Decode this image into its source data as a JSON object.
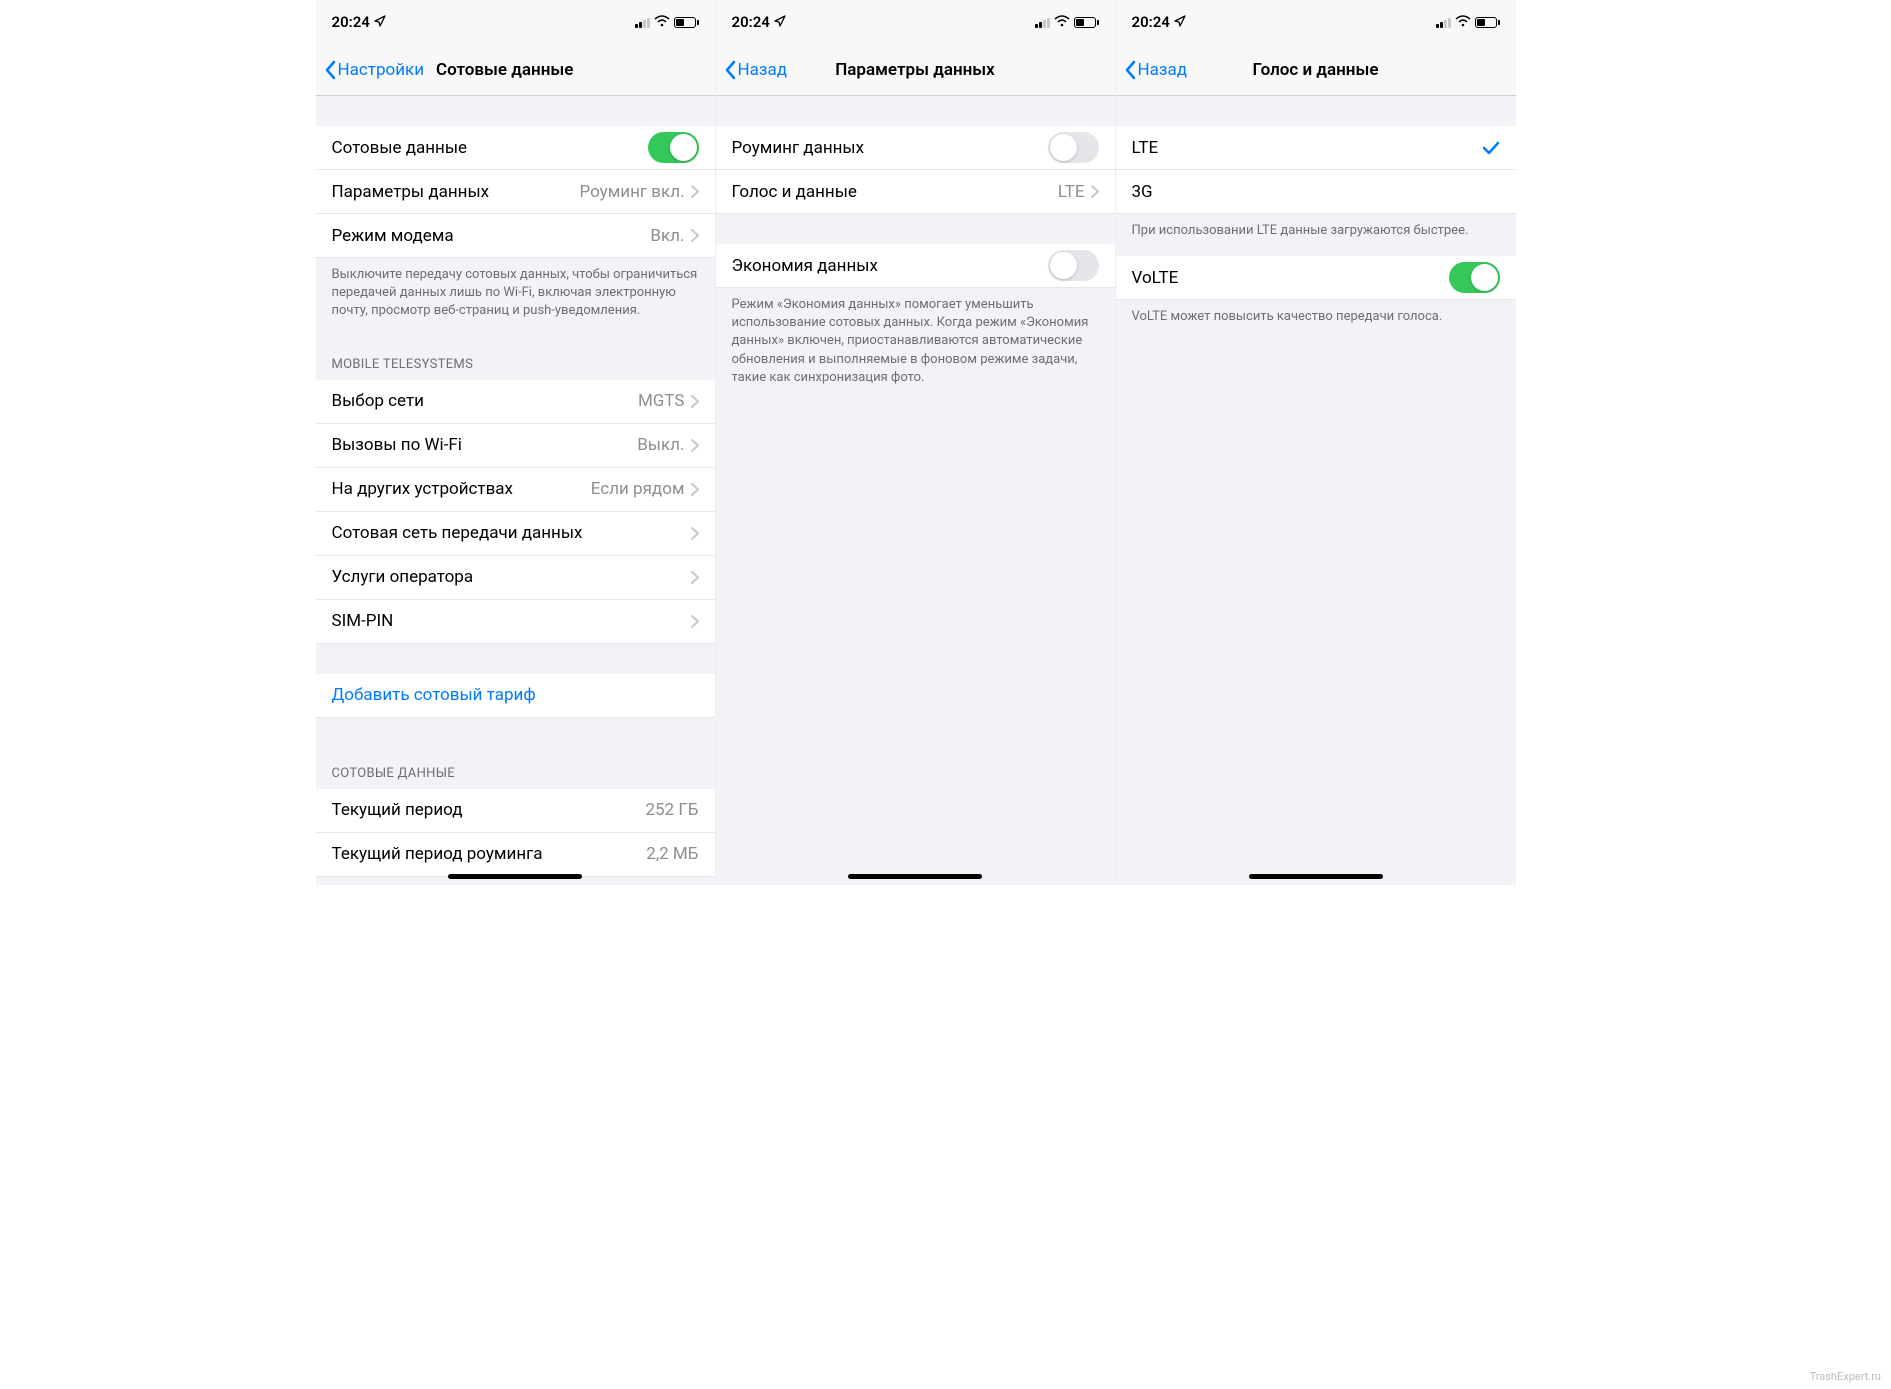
{
  "status": {
    "time": "20:24"
  },
  "screen1": {
    "back": "Настройки",
    "title": "Сотовые данные",
    "cells": {
      "cellular_data": "Сотовые данные",
      "data_options": "Параметры данных",
      "data_options_val": "Роуминг вкл.",
      "hotspot": "Режим модема",
      "hotspot_val": "Вкл.",
      "footer1": "Выключите передачу сотовых данных, чтобы ограничиться передачей данных лишь по Wi-Fi, включая электронную почту, просмотр веб-страниц и push-уведомления.",
      "carrier_header": "MOBILE TELESYSTEMS",
      "network_sel": "Выбор сети",
      "network_sel_val": "MGTS",
      "wifi_calling": "Вызовы по Wi-Fi",
      "wifi_calling_val": "Выкл.",
      "other_devices": "На других устройствах",
      "other_devices_val": "Если рядом",
      "cell_network": "Сотовая сеть передачи данных",
      "carrier_services": "Услуги оператора",
      "sim_pin": "SIM-PIN",
      "add_plan": "Добавить сотовый тариф",
      "usage_header": "СОТОВЫЕ ДАННЫЕ",
      "current_period": "Текущий период",
      "current_period_val": "252 ГБ",
      "roaming_period": "Текущий период роуминга",
      "roaming_period_val": "2,2 МБ"
    }
  },
  "screen2": {
    "back": "Назад",
    "title": "Параметры данных",
    "roaming": "Роуминг данных",
    "voice_data": "Голос и данные",
    "voice_data_val": "LTE",
    "low_data": "Экономия данных",
    "low_data_footer": "Режим «Экономия данных» помогает уменьшить использование сотовых данных. Когда режим «Экономия данных» включен, приостанавливаются автоматические обновления и выполняемые в фоновом режиме задачи, такие как синхронизация фото."
  },
  "screen3": {
    "back": "Назад",
    "title": "Голос и данные",
    "lte": "LTE",
    "three_g": "3G",
    "lte_footer": "При использовании LTE данные загружаются быстрее.",
    "volte": "VoLTE",
    "volte_footer": "VoLTE может повысить качество передачи голоса."
  },
  "watermark": "TrashExpert.ru"
}
